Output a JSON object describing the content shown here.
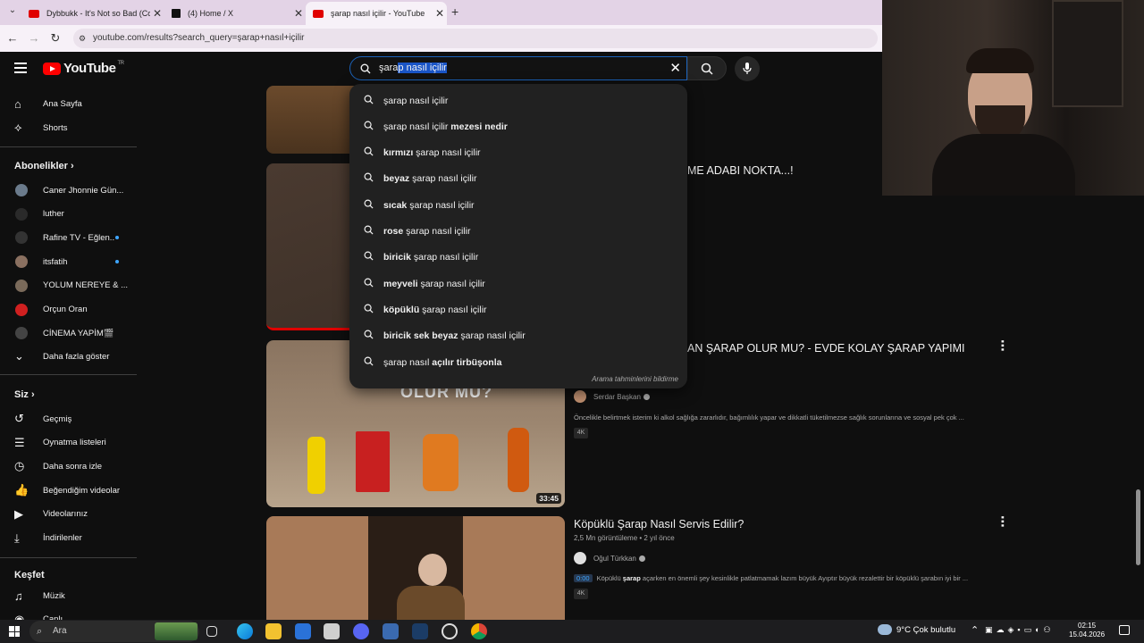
{
  "browser": {
    "tabs": [
      {
        "title": "Dybbukk - It's Not so Bad (Cov",
        "close": "✕",
        "favicon": "youtube-icon",
        "color": "#e00000"
      },
      {
        "title": "(4) Home / X",
        "close": "✕",
        "favicon": "x-icon",
        "color": "#111111"
      },
      {
        "title": "şarap nasıl içilir - YouTube",
        "close": "✕",
        "favicon": "youtube-icon",
        "color": "#e00000"
      }
    ],
    "new_tab": "+",
    "url": "youtube.com/results?search_query=şarap+nasıl+içilir"
  },
  "youtube": {
    "logo_text": "YouTube",
    "logo_sup": "TR",
    "search": {
      "query_prefix": "şara",
      "query_selected": "p nasıl içilir",
      "clear": "✕"
    },
    "suggestions": [
      {
        "pre": "",
        "bold": "",
        "text": "şarap nasıl içilir",
        "post": ""
      },
      {
        "pre": "",
        "bold": "",
        "text": "şarap nasıl içilir ",
        "post": "mezesi nedir"
      },
      {
        "pre": "kırmızı",
        "bold": "",
        "text": " şarap nasıl içilir",
        "post": ""
      },
      {
        "pre": "beyaz",
        "bold": "",
        "text": " şarap nasıl içilir",
        "post": ""
      },
      {
        "pre": "sıcak",
        "bold": "",
        "text": " şarap nasıl içilir",
        "post": ""
      },
      {
        "pre": "rose",
        "bold": "",
        "text": " şarap nasıl içilir",
        "post": ""
      },
      {
        "pre": "biricik",
        "bold": "",
        "text": " şarap nasıl içilir",
        "post": ""
      },
      {
        "pre": "meyveli",
        "bold": "",
        "text": " şarap nasıl içilir",
        "post": ""
      },
      {
        "pre": "köpüklü",
        "bold": "",
        "text": " şarap nasıl içilir",
        "post": ""
      },
      {
        "pre": "biricik sek beyaz",
        "bold": "",
        "text": " şarap nasıl içilir",
        "post": ""
      },
      {
        "pre": "",
        "bold": "",
        "text": "şarap nasıl ",
        "post": "açılır tirbüşonla"
      }
    ],
    "suggest_footer": "Arama tahminlerini bildirme",
    "sidebar": {
      "home": "Ana Sayfa",
      "shorts": "Shorts",
      "subs_header": "Abonelikler",
      "subs": [
        {
          "name": "Caner Jhonnie Gün...",
          "color": "#6b7b8c",
          "dot": false
        },
        {
          "name": "luther",
          "color": "#2a2a2a",
          "dot": false
        },
        {
          "name": "Rafine TV - Eğlen...",
          "color": "#333333",
          "dot": true
        },
        {
          "name": "itsfatih",
          "color": "#8a7060",
          "dot": true
        },
        {
          "name": "YOLUM NEREYE & ...",
          "color": "#7a6a5a",
          "dot": false
        },
        {
          "name": "Orçun Oran",
          "color": "#d02020",
          "dot": false
        },
        {
          "name": "CİNEMA YAPİM🎬",
          "color": "#444444",
          "dot": false
        }
      ],
      "more": "Daha fazla göster",
      "you_header": "Siz",
      "you_items": [
        "Geçmiş",
        "Oynatma listeleri",
        "Daha sonra izle",
        "Beğendiğim videolar",
        "Videolarınız",
        "İndirilenler"
      ],
      "explore_header": "Keşfet",
      "explore_items": [
        "Müzik",
        "Canlı"
      ]
    },
    "videos": [
      {
        "title_partial": "ME ADABI NOKTA...!"
      },
      {
        "title_partial": "AN ŞARAP OLUR MU? - EVDE KOLAY ŞARAP YAPIMI",
        "channel": "Serdar Başkan",
        "desc": "Öncelikle belirtmek isterim ki alkol sağlığa zararlıdır, bağımlılık yapar ve dikkatli tüketilmezse sağlık sorunlarına ve sosyal pek çok ...",
        "badge": "4K",
        "duration": "33:45"
      },
      {
        "title": "Köpüklü Şarap Nasıl Servis Edilir?",
        "meta": "2,5 Mn görüntüleme • 2 yıl önce",
        "channel": "Oğul Türkkan",
        "desc_ts": "0:00",
        "desc_pre": "Köpüklü ",
        "desc_bold": "şarap",
        "desc_post": " açarken en önemli şey kesinlikle patlatmamak lazım büyük Ayıptır büyük rezalettir bir köpüklü şarabın iyi bir ...",
        "badge": "4K"
      }
    ]
  },
  "taskbar": {
    "search": "Ara",
    "weather": "9°C  Çok bulutlu",
    "time": "02:15",
    "date": "15.04.2026"
  }
}
